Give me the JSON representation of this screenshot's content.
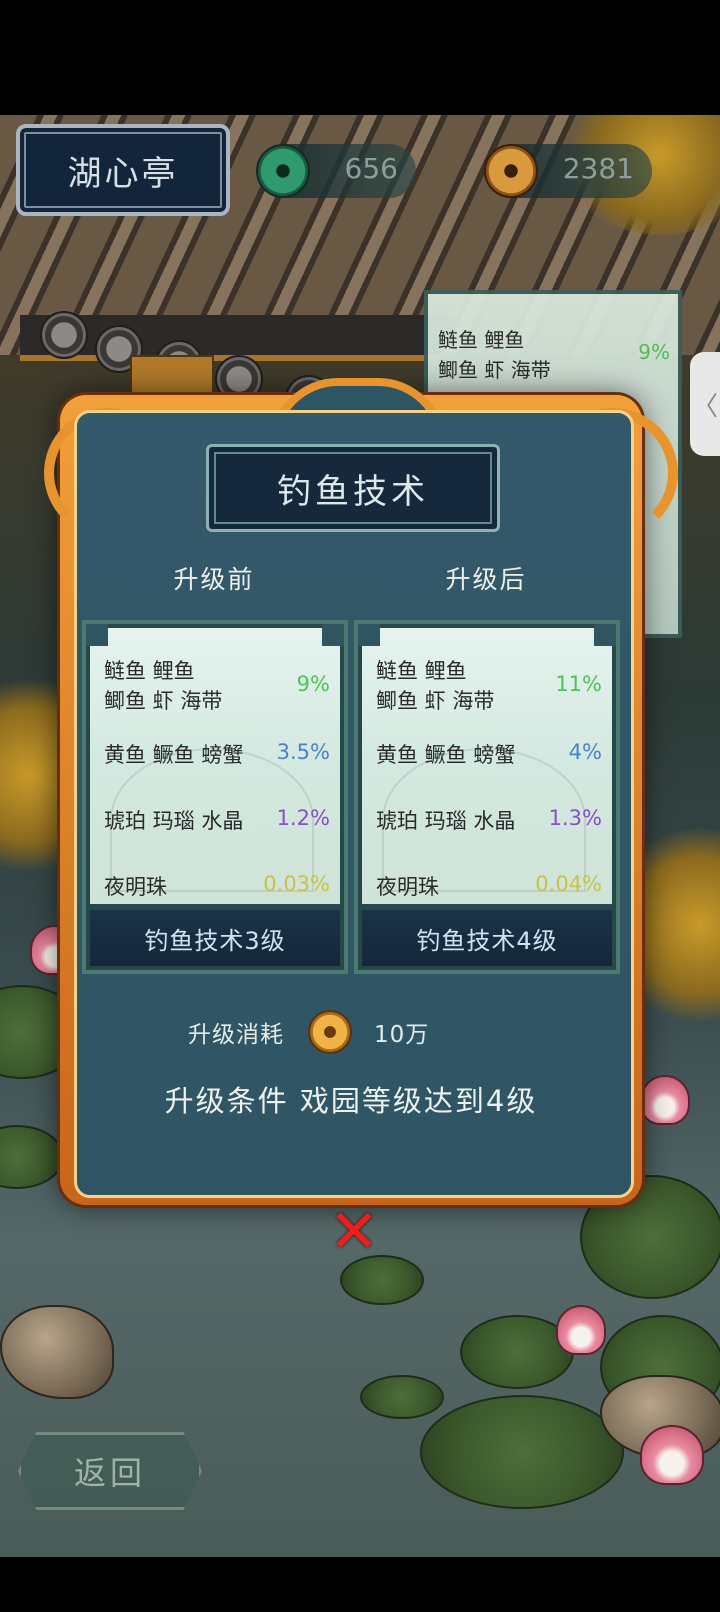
{
  "location": {
    "name": "湖心亭"
  },
  "currencies": [
    {
      "icon": "jade-coin-icon",
      "value": "656"
    },
    {
      "icon": "copper-coin-icon",
      "value": "2381"
    }
  ],
  "background_card": {
    "rows": [
      {
        "label": "鲢鱼  鲤鱼",
        "pct": ""
      },
      {
        "label": "鲫鱼  虾  海带",
        "pct": "9%"
      }
    ]
  },
  "side_tab": {
    "glyph": "〈"
  },
  "modal": {
    "title": "钓鱼技术",
    "before_header": "升级前",
    "after_header": "升级后",
    "before": {
      "rows": [
        {
          "label_line1": "鲢鱼  鲤鱼",
          "label_line2": "鲫鱼  虾  海带",
          "pct": "9%"
        },
        {
          "label": "黄鱼  鳜鱼  螃蟹",
          "pct": "3.5%"
        },
        {
          "label": "琥珀  玛瑙  水晶",
          "pct": "1.2%"
        },
        {
          "label": "夜明珠",
          "pct": "0.03%"
        }
      ],
      "footer": "钓鱼技术3级"
    },
    "after": {
      "rows": [
        {
          "label_line1": "鲢鱼  鲤鱼",
          "label_line2": "鲫鱼  虾  海带",
          "pct": "11%"
        },
        {
          "label": "黄鱼  鳜鱼  螃蟹",
          "pct": "4%"
        },
        {
          "label": "琥珀  玛瑙  水晶",
          "pct": "1.3%"
        },
        {
          "label": "夜明珠",
          "pct": "0.04%"
        }
      ],
      "footer": "钓鱼技术4级"
    },
    "cost_label": "升级消耗",
    "cost_value": "10万",
    "condition": "升级条件  戏园等级达到4级",
    "close_glyph": "✕"
  },
  "back_button": {
    "label": "返回"
  },
  "colors": {
    "common": "#4ec452",
    "uncommon": "#4a82cc",
    "rare": "#8a4ec6",
    "legendary": "#c8c24a",
    "frame": "#e8942e"
  }
}
